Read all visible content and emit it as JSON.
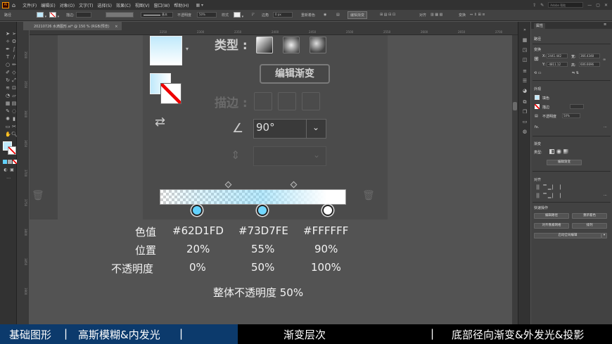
{
  "menubar": {
    "logo": "Ai",
    "menus": [
      "文件(F)",
      "编辑(E)",
      "对象(O)",
      "文字(T)",
      "选择(S)",
      "效果(C)",
      "视图(V)",
      "窗口(W)",
      "帮助(H)"
    ],
    "search_placeholder": "Adobe 帮助"
  },
  "controlbar": {
    "path_label": "路径",
    "stroke_label": "描边:",
    "basic_label": "基本",
    "opacity_label": "不透明度",
    "opacity_value": "50%",
    "style_label": "样式",
    "corner_label": "边角",
    "corner_value": "0 px",
    "recolor_label": "重新着色",
    "edit_gradient": "编辑渐变",
    "align_label": "对齐",
    "transform_label": "变换"
  },
  "document_tab": {
    "title": "20210726 水滴图形.ai* @ 150 % (RGB/预览)",
    "close": "×"
  },
  "ruler_top": [
    "2250",
    "2300",
    "2350",
    "2400",
    "2450",
    "2500",
    "2550",
    "2600",
    "2650",
    "2700"
  ],
  "ruler_left": [
    "3500",
    "3550",
    "3600",
    "3650",
    "3700",
    "3750",
    "3800",
    "3850",
    "3900",
    "3950"
  ],
  "gradient_panel": {
    "type_label": "类型 :",
    "edit_gradient_button": "编辑渐变",
    "stroke_label": "描边 :",
    "angle_value": "90°",
    "stops": [
      {
        "color": "#62D1FD",
        "location": 20
      },
      {
        "color": "#73D7FE",
        "location": 55
      },
      {
        "color": "#FFFFFF",
        "location": 90
      }
    ],
    "midpoints": [
      37,
      72
    ]
  },
  "gradient_info": {
    "color_label": "色值",
    "colors": [
      "#62D1FD",
      "#73D7FE",
      "#FFFFFF"
    ],
    "position_label": "位置",
    "positions": [
      "20%",
      "55%",
      "90%"
    ],
    "opacity_label": "不透明度",
    "opacities": [
      "0%",
      "50%",
      "100%"
    ],
    "overall": "整体不透明度 50%"
  },
  "properties_panel": {
    "tab": "属性",
    "section_path": "路径",
    "transform_title": "变换",
    "x_label": "X:",
    "x_value": "2441.442",
    "y_label": "Y:",
    "y_value": "-4811.12",
    "w_label": "宽:",
    "w_value": "366.4348",
    "h_label": "高:",
    "h_value": "606.6696",
    "appearance_title": "外观",
    "fill_label": "填色",
    "stroke_label": "描边",
    "opacity_label": "不透明度",
    "opacity_value": "50%",
    "fx": "fx.",
    "gradient_title": "渐变",
    "gradient_type_label": "类型:",
    "edit_gradient": "编辑渐变",
    "align_title": "对齐",
    "quick_actions_title": "快速操作",
    "btn_edit_path": "编辑路径",
    "btn_recolor": "重新着色",
    "btn_align_pixel": "对齐像素网格",
    "btn_arrange": "排列",
    "btn_global_edit": "启动全局编辑"
  },
  "bottom_bar": {
    "seg1": "基础图形",
    "sep": "|",
    "seg2": "高斯模糊&内发光",
    "seg3": "渐变层次",
    "seg4": "底部径向渐变&外发光&投影"
  },
  "colors": {
    "stop1": "#62D1FD",
    "stop2": "#73D7FE",
    "stop3": "#FFFFFF",
    "bottom_highlight": "#0c3a6c"
  }
}
